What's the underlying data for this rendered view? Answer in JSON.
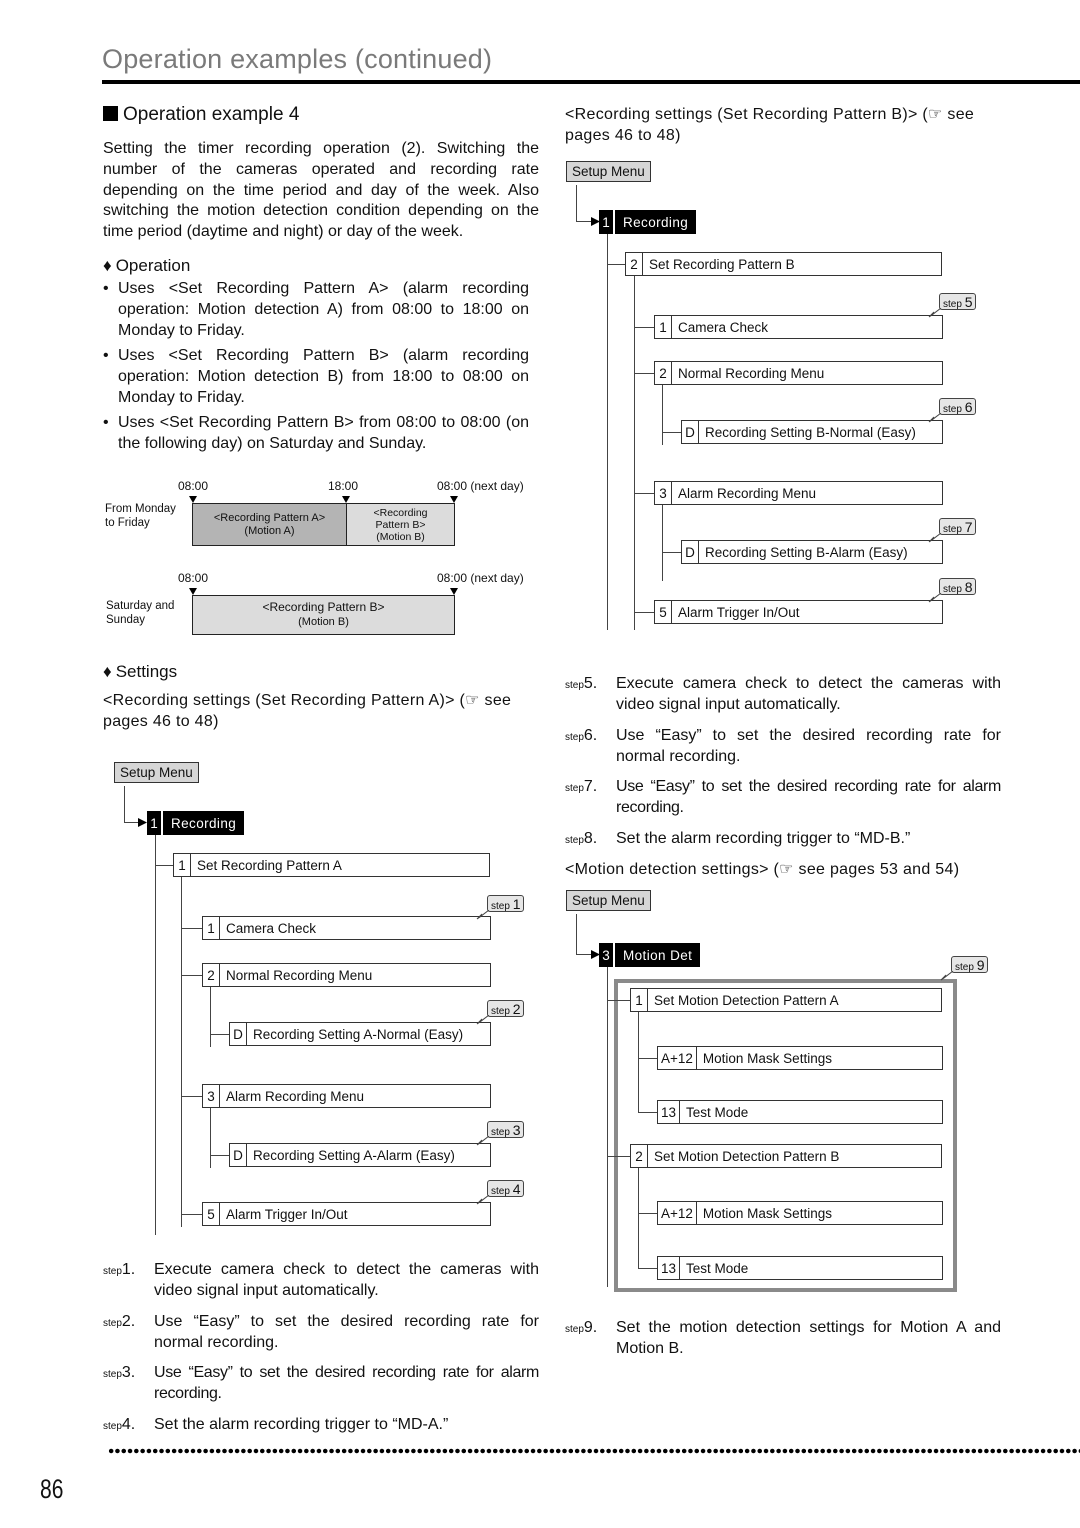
{
  "header": {
    "title": "Operation examples (continued)"
  },
  "section": {
    "title": "Operation example 4",
    "intro": "Setting the timer recording operation (2). Switching the number of the cameras operated and recording rate depending on the time period and day of the week. Also switching the motion detection condition depending on the time period (daytime and night) or day of the week."
  },
  "operation": {
    "heading": "Operation",
    "bullets": [
      "Uses <Set Recording Pattern A> (alarm recording operation: Motion detection A) from 08:00 to 18:00 on Monday to Friday.",
      "Uses <Set Recording Pattern B> (alarm recording operation: Motion detection B) from 18:00 to 08:00 on Monday to Friday.",
      "Uses <Set Recording Pattern B> from 08:00 to 08:00 (on the following day) on Saturday and Sunday."
    ]
  },
  "timeline": {
    "weekday": {
      "label_line1": "From Monday",
      "label_line2": "to Friday",
      "times": [
        "08:00",
        "18:00",
        "08:00 (next day)"
      ],
      "segments": [
        {
          "line1": "<Recording Pattern A>",
          "line2": "(Motion A)",
          "color": "#b4b4b4"
        },
        {
          "line1": "<Recording",
          "line2": "Pattern B>",
          "line3": "(Motion B)",
          "color": "#dcdcdc"
        }
      ]
    },
    "weekend": {
      "label_line1": "Saturday and",
      "label_line2": "Sunday",
      "times": [
        "08:00",
        "08:00 (next day)"
      ],
      "segment": {
        "line1": "<Recording Pattern B>",
        "line2": "(Motion B)",
        "color": "#dcdcdc"
      }
    }
  },
  "settings": {
    "heading": "Settings",
    "ref_a": "<Recording settings (Set Recording Pattern A)> (☞ see pages 46 to 48)",
    "ref_b": "<Recording settings (Set Recording Pattern B)> (☞ see pages 46 to 48)",
    "ref_motion": "<Motion detection settings> (☞ see pages 53 and 54)"
  },
  "tree_a": {
    "root": "Setup Menu",
    "menu": {
      "num": "1",
      "label": "Recording"
    },
    "pattern": {
      "num": "1",
      "label": "Set Recording Pattern A"
    },
    "items": [
      {
        "num": "1",
        "label": "Camera Check",
        "step": "1"
      },
      {
        "num": "2",
        "label": "Normal Recording Menu"
      },
      {
        "num": "D",
        "label": "Recording Setting A-Normal (Easy)",
        "step": "2"
      },
      {
        "num": "3",
        "label": "Alarm Recording Menu"
      },
      {
        "num": "D",
        "label": "Recording Setting A-Alarm (Easy)",
        "step": "3"
      },
      {
        "num": "5",
        "label": "Alarm Trigger In/Out",
        "step": "4"
      }
    ]
  },
  "tree_b": {
    "root": "Setup Menu",
    "menu": {
      "num": "1",
      "label": "Recording"
    },
    "pattern": {
      "num": "2",
      "label": "Set Recording Pattern B"
    },
    "items": [
      {
        "num": "1",
        "label": "Camera Check",
        "step": "5"
      },
      {
        "num": "2",
        "label": "Normal Recording Menu"
      },
      {
        "num": "D",
        "label": "Recording Setting B-Normal (Easy)",
        "step": "6"
      },
      {
        "num": "3",
        "label": "Alarm Recording Menu"
      },
      {
        "num": "D",
        "label": "Recording Setting B-Alarm (Easy)",
        "step": "7"
      },
      {
        "num": "5",
        "label": "Alarm Trigger In/Out",
        "step": "8"
      }
    ]
  },
  "tree_m": {
    "root": "Setup Menu",
    "menu": {
      "num": "3",
      "label": "Motion Det"
    },
    "step": "9",
    "items": [
      {
        "num": "1",
        "label": "Set Motion Detection Pattern A"
      },
      {
        "num": "A+12",
        "label": "Motion Mask Settings"
      },
      {
        "num": "13",
        "label": "Test Mode"
      },
      {
        "num": "2",
        "label": "Set Motion Detection Pattern B"
      },
      {
        "num": "A+12",
        "label": "Motion Mask Settings"
      },
      {
        "num": "13",
        "label": "Test Mode"
      }
    ]
  },
  "steps": [
    {
      "n": "1.",
      "text": "Execute camera check to detect the cameras with video signal input automatically."
    },
    {
      "n": "2.",
      "text": "Use “Easy” to set the desired recording rate for normal recording."
    },
    {
      "n": "3.",
      "text": "Use “Easy” to set the desired recording rate for alarm recording."
    },
    {
      "n": "4.",
      "text": "Set the alarm recording trigger to “MD-A.”"
    },
    {
      "n": "5.",
      "text": "Execute camera check to detect the cameras with video signal input automatically."
    },
    {
      "n": "6.",
      "text": "Use “Easy” to set the desired recording rate for normal recording."
    },
    {
      "n": "7.",
      "text": "Use “Easy” to set the desired recording rate for alarm recording."
    },
    {
      "n": "8.",
      "text": "Set the alarm recording trigger to “MD-B.”"
    },
    {
      "n": "9.",
      "text": "Set the motion detection settings for Motion A and Motion B."
    }
  ],
  "step_prefix": "step",
  "bullet_char": "•",
  "diamond_char": "♦",
  "footer": {
    "page_number": "86"
  }
}
